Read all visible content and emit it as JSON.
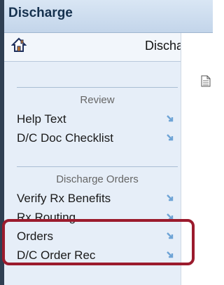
{
  "header": {
    "title": "Discharge"
  },
  "toolbar": {
    "title": "Discharge",
    "home_icon": "home-icon"
  },
  "sections": [
    {
      "heading": "Review",
      "items": [
        {
          "label": "Help Text"
        },
        {
          "label": "D/C Doc Checklist"
        }
      ]
    },
    {
      "heading": "Discharge Orders",
      "items": [
        {
          "label": "Verify Rx Benefits"
        },
        {
          "label": "Rx Routing"
        },
        {
          "label": "Orders"
        },
        {
          "label": "D/C Order Rec"
        }
      ]
    }
  ],
  "colors": {
    "accent": "#16324f",
    "arrow": "#6ea4d6",
    "highlight": "#9b1b2d"
  },
  "icons": {
    "item_arrow": "arrow-down-right-icon",
    "document": "document-icon"
  }
}
